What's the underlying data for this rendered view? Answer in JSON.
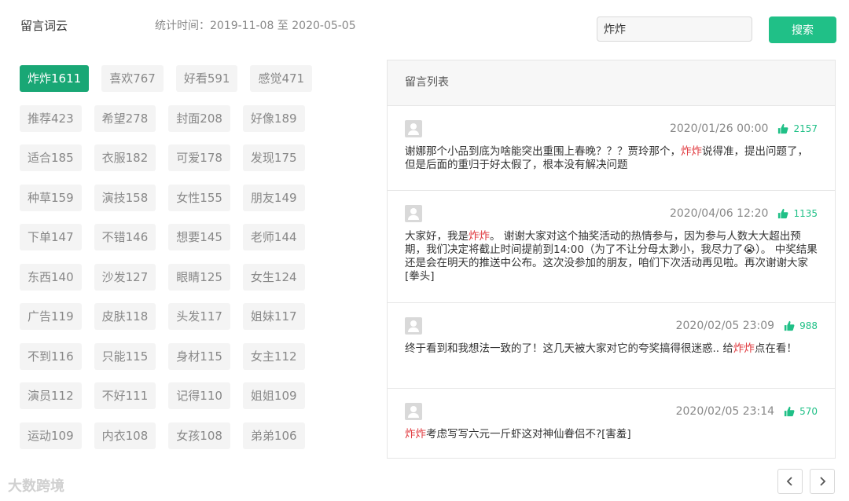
{
  "header": {
    "title": "留言词云",
    "stat_time": "统计时间：2019-11-08 至 2020-05-05"
  },
  "search": {
    "value": "炸炸",
    "button_label": "搜索"
  },
  "colors": {
    "accent": "#20c087",
    "active_tag": "#19a775",
    "highlight": "#e0393e"
  },
  "word_cloud": [
    [
      "炸炸1611",
      "喜欢767",
      "好看591",
      "感觉471"
    ],
    [
      "推荐423",
      "希望278",
      "封面208",
      "好像189"
    ],
    [
      "适合185",
      "衣服182",
      "可爱178",
      "发现175"
    ],
    [
      "种草159",
      "演技158",
      "女性155",
      "朋友149"
    ],
    [
      "下单147",
      "不错146",
      "想要145",
      "老师144"
    ],
    [
      "东西140",
      "沙发127",
      "眼睛125",
      "女生124"
    ],
    [
      "广告119",
      "皮肤118",
      "头发117",
      "姐妹117"
    ],
    [
      "不到116",
      "只能115",
      "身材115",
      "女主112"
    ],
    [
      "演员112",
      "不好111",
      "记得110",
      "姐姐109"
    ],
    [
      "运动109",
      "内衣108",
      "女孩108",
      "弟弟106"
    ]
  ],
  "message_list": {
    "title": "留言列表",
    "items": [
      {
        "time": "2020/01/26 00:00",
        "likes": "2157",
        "text_before": "谢娜那个小品到底为啥能突出重围上春晚？？？贾玲那个，",
        "keyword": "炸炸",
        "text_after": "说得准，提出问题了，但是后面的重归于好太假了，根本没有解决问题"
      },
      {
        "time": "2020/04/06 12:20",
        "likes": "1135",
        "text_before": "大家好，我是",
        "keyword": "炸炸",
        "text_after": "。 谢谢大家对这个抽奖活动的热情参与，因为参与人数大大超出预期，我们决定将截止时间提前到14:00（为了不让分母太渺小，我尽力了😭）。 中奖结果还是会在明天的推送中公布。这次没参加的朋友，咱们下次活动再见啦。再次谢谢大家[拳头]"
      },
      {
        "time": "2020/02/05 23:09",
        "likes": "988",
        "text_before": "终于看到和我想法一致的了！这几天被大家对它的夸奖搞得很迷惑.. 给",
        "keyword": "炸炸",
        "text_after": "点在看！"
      },
      {
        "time": "2020/02/05 23:14",
        "likes": "570",
        "text_before": "",
        "keyword": "炸炸",
        "text_after": "考虑写写六元一斤虾这对神仙眷侣不?[害羞]"
      }
    ]
  },
  "watermark": "大数跨境",
  "icons": {
    "like": "thumbs-up-icon",
    "avatar": "user-avatar-icon",
    "prev": "chevron-left-icon",
    "next": "chevron-right-icon"
  }
}
